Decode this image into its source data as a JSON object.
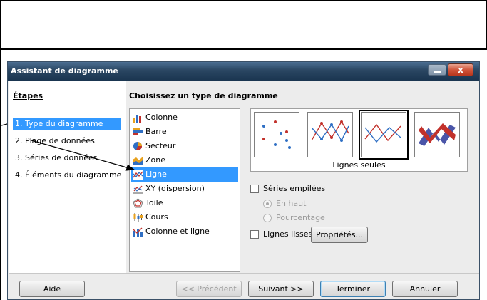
{
  "dialog": {
    "title": "Assistant de diagramme",
    "close_label": "x"
  },
  "steps": {
    "heading": "Étapes",
    "items": [
      {
        "label": "1. Type du diagramme",
        "active": true
      },
      {
        "label": "2. Plage de données",
        "active": false
      },
      {
        "label": "3. Séries de données",
        "active": false
      },
      {
        "label": "4. Éléments du diagramme",
        "active": false
      }
    ]
  },
  "chart_types": {
    "heading": "Choisissez un type de diagramme",
    "items": [
      {
        "label": "Colonne",
        "icon": "column-chart-icon"
      },
      {
        "label": "Barre",
        "icon": "bar-chart-icon"
      },
      {
        "label": "Secteur",
        "icon": "pie-chart-icon"
      },
      {
        "label": "Zone",
        "icon": "area-chart-icon"
      },
      {
        "label": "Ligne",
        "icon": "line-chart-icon",
        "selected": true
      },
      {
        "label": "XY (dispersion)",
        "icon": "xy-scatter-icon"
      },
      {
        "label": "Toile",
        "icon": "net-chart-icon"
      },
      {
        "label": "Cours",
        "icon": "stock-chart-icon"
      },
      {
        "label": "Colonne et ligne",
        "icon": "column-line-chart-icon"
      }
    ]
  },
  "variants": {
    "caption": "Lignes seules",
    "items": [
      "points-only-icon",
      "points-and-lines-icon",
      "lines-only-icon",
      "3d-lines-icon"
    ],
    "selected_index": 2
  },
  "options": {
    "stacked_label": "Séries empilées",
    "stacked_checked": false,
    "on_top_label": "En haut",
    "percent_label": "Pourcentage",
    "smooth_label": "Lignes lisses",
    "smooth_checked": false,
    "properties_button": "Propriétés..."
  },
  "buttons": {
    "help": "Aide",
    "previous": "<< Précédent",
    "next": "Suivant >>",
    "finish": "Terminer",
    "cancel": "Annuler"
  },
  "colors": {
    "selection": "#3399ff",
    "title_bar": "#2a4662",
    "close_button": "#c8432a"
  }
}
